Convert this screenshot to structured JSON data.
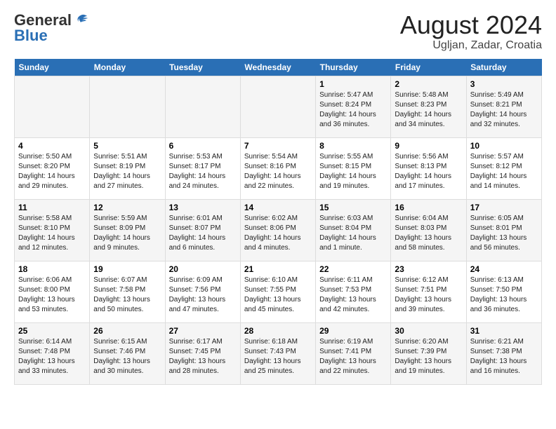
{
  "logo": {
    "general": "General",
    "blue": "Blue"
  },
  "title": "August 2024",
  "subtitle": "Ugljan, Zadar, Croatia",
  "days_of_week": [
    "Sunday",
    "Monday",
    "Tuesday",
    "Wednesday",
    "Thursday",
    "Friday",
    "Saturday"
  ],
  "weeks": [
    [
      {
        "day": "",
        "info": ""
      },
      {
        "day": "",
        "info": ""
      },
      {
        "day": "",
        "info": ""
      },
      {
        "day": "",
        "info": ""
      },
      {
        "day": "1",
        "info": "Sunrise: 5:47 AM\nSunset: 8:24 PM\nDaylight: 14 hours and 36 minutes."
      },
      {
        "day": "2",
        "info": "Sunrise: 5:48 AM\nSunset: 8:23 PM\nDaylight: 14 hours and 34 minutes."
      },
      {
        "day": "3",
        "info": "Sunrise: 5:49 AM\nSunset: 8:21 PM\nDaylight: 14 hours and 32 minutes."
      }
    ],
    [
      {
        "day": "4",
        "info": "Sunrise: 5:50 AM\nSunset: 8:20 PM\nDaylight: 14 hours and 29 minutes."
      },
      {
        "day": "5",
        "info": "Sunrise: 5:51 AM\nSunset: 8:19 PM\nDaylight: 14 hours and 27 minutes."
      },
      {
        "day": "6",
        "info": "Sunrise: 5:53 AM\nSunset: 8:17 PM\nDaylight: 14 hours and 24 minutes."
      },
      {
        "day": "7",
        "info": "Sunrise: 5:54 AM\nSunset: 8:16 PM\nDaylight: 14 hours and 22 minutes."
      },
      {
        "day": "8",
        "info": "Sunrise: 5:55 AM\nSunset: 8:15 PM\nDaylight: 14 hours and 19 minutes."
      },
      {
        "day": "9",
        "info": "Sunrise: 5:56 AM\nSunset: 8:13 PM\nDaylight: 14 hours and 17 minutes."
      },
      {
        "day": "10",
        "info": "Sunrise: 5:57 AM\nSunset: 8:12 PM\nDaylight: 14 hours and 14 minutes."
      }
    ],
    [
      {
        "day": "11",
        "info": "Sunrise: 5:58 AM\nSunset: 8:10 PM\nDaylight: 14 hours and 12 minutes."
      },
      {
        "day": "12",
        "info": "Sunrise: 5:59 AM\nSunset: 8:09 PM\nDaylight: 14 hours and 9 minutes."
      },
      {
        "day": "13",
        "info": "Sunrise: 6:01 AM\nSunset: 8:07 PM\nDaylight: 14 hours and 6 minutes."
      },
      {
        "day": "14",
        "info": "Sunrise: 6:02 AM\nSunset: 8:06 PM\nDaylight: 14 hours and 4 minutes."
      },
      {
        "day": "15",
        "info": "Sunrise: 6:03 AM\nSunset: 8:04 PM\nDaylight: 14 hours and 1 minute."
      },
      {
        "day": "16",
        "info": "Sunrise: 6:04 AM\nSunset: 8:03 PM\nDaylight: 13 hours and 58 minutes."
      },
      {
        "day": "17",
        "info": "Sunrise: 6:05 AM\nSunset: 8:01 PM\nDaylight: 13 hours and 56 minutes."
      }
    ],
    [
      {
        "day": "18",
        "info": "Sunrise: 6:06 AM\nSunset: 8:00 PM\nDaylight: 13 hours and 53 minutes."
      },
      {
        "day": "19",
        "info": "Sunrise: 6:07 AM\nSunset: 7:58 PM\nDaylight: 13 hours and 50 minutes."
      },
      {
        "day": "20",
        "info": "Sunrise: 6:09 AM\nSunset: 7:56 PM\nDaylight: 13 hours and 47 minutes."
      },
      {
        "day": "21",
        "info": "Sunrise: 6:10 AM\nSunset: 7:55 PM\nDaylight: 13 hours and 45 minutes."
      },
      {
        "day": "22",
        "info": "Sunrise: 6:11 AM\nSunset: 7:53 PM\nDaylight: 13 hours and 42 minutes."
      },
      {
        "day": "23",
        "info": "Sunrise: 6:12 AM\nSunset: 7:51 PM\nDaylight: 13 hours and 39 minutes."
      },
      {
        "day": "24",
        "info": "Sunrise: 6:13 AM\nSunset: 7:50 PM\nDaylight: 13 hours and 36 minutes."
      }
    ],
    [
      {
        "day": "25",
        "info": "Sunrise: 6:14 AM\nSunset: 7:48 PM\nDaylight: 13 hours and 33 minutes."
      },
      {
        "day": "26",
        "info": "Sunrise: 6:15 AM\nSunset: 7:46 PM\nDaylight: 13 hours and 30 minutes."
      },
      {
        "day": "27",
        "info": "Sunrise: 6:17 AM\nSunset: 7:45 PM\nDaylight: 13 hours and 28 minutes."
      },
      {
        "day": "28",
        "info": "Sunrise: 6:18 AM\nSunset: 7:43 PM\nDaylight: 13 hours and 25 minutes."
      },
      {
        "day": "29",
        "info": "Sunrise: 6:19 AM\nSunset: 7:41 PM\nDaylight: 13 hours and 22 minutes."
      },
      {
        "day": "30",
        "info": "Sunrise: 6:20 AM\nSunset: 7:39 PM\nDaylight: 13 hours and 19 minutes."
      },
      {
        "day": "31",
        "info": "Sunrise: 6:21 AM\nSunset: 7:38 PM\nDaylight: 13 hours and 16 minutes."
      }
    ]
  ]
}
